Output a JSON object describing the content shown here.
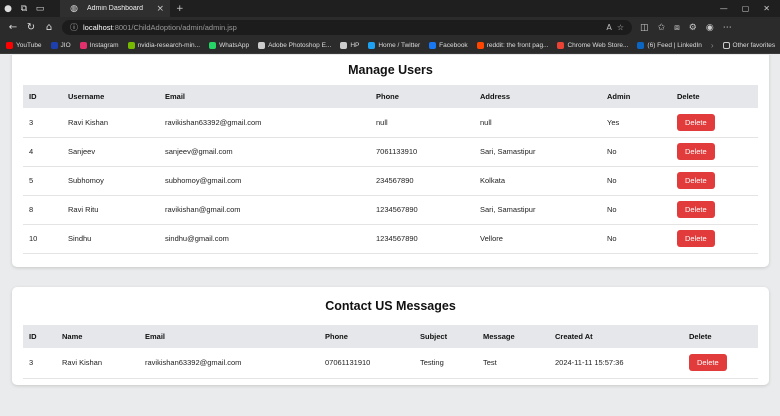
{
  "browser": {
    "tab_title": "Admin Dashboard",
    "url_host": "localhost",
    "url_path": ":8001/ChildAdoption/admin/admin.jsp",
    "bookmarks": [
      {
        "label": "YouTube",
        "color": "#ff0000"
      },
      {
        "label": "JIO",
        "color": "#1e40af"
      },
      {
        "label": "Instagram",
        "color": "#e1306c"
      },
      {
        "label": "nvidia-research-min...",
        "color": "#76b900"
      },
      {
        "label": "WhatsApp",
        "color": "#25d366"
      },
      {
        "label": "Adobe Photoshop E...",
        "color": "#cccccc"
      },
      {
        "label": "HP",
        "color": "#cccccc"
      },
      {
        "label": "Home / Twitter",
        "color": "#1da1f2"
      },
      {
        "label": "Facebook",
        "color": "#1877f2"
      },
      {
        "label": "reddit: the front pag...",
        "color": "#ff4500"
      },
      {
        "label": "Chrome Web Store...",
        "color": "#ea4335"
      },
      {
        "label": "(6) Feed | LinkedIn",
        "color": "#0a66c2"
      }
    ],
    "other_favorites": "Other favorites"
  },
  "users": {
    "title": "Manage Users",
    "columns": [
      "ID",
      "Username",
      "Email",
      "Phone",
      "Address",
      "Admin",
      "Delete"
    ],
    "rows": [
      {
        "id": "3",
        "username": "Ravi Kishan",
        "email": "ravikishan63392@gmail.com",
        "phone": "null",
        "address": "null",
        "admin": "Yes"
      },
      {
        "id": "4",
        "username": "Sanjeev",
        "email": "sanjeev@gmail.com",
        "phone": "7061133910",
        "address": "Sari, Samastipur",
        "admin": "No"
      },
      {
        "id": "5",
        "username": "Subhomoy",
        "email": "subhomoy@gmail.com",
        "phone": "234567890",
        "address": "Kolkata",
        "admin": "No"
      },
      {
        "id": "8",
        "username": "Ravi Ritu",
        "email": "ravikishan@gmail.com",
        "phone": "1234567890",
        "address": "Sari, Samastipur",
        "admin": "No"
      },
      {
        "id": "10",
        "username": "Sindhu",
        "email": "sindhu@gmail.com",
        "phone": "1234567890",
        "address": "Vellore",
        "admin": "No"
      }
    ],
    "delete_label": "Delete"
  },
  "messages": {
    "title": "Contact US Messages",
    "columns": [
      "ID",
      "Name",
      "Email",
      "Phone",
      "Subject",
      "Message",
      "Created At",
      "Delete"
    ],
    "rows": [
      {
        "id": "3",
        "name": "Ravi Kishan",
        "email": "ravikishan63392@gmail.com",
        "phone": "07061131910",
        "subject": "Testing",
        "message": "Test",
        "created_at": "2024-11-11 15:57:36"
      }
    ],
    "delete_label": "Delete"
  },
  "colors": {
    "delete_button": "#e23b3b",
    "table_header": "#e5e7ea"
  }
}
